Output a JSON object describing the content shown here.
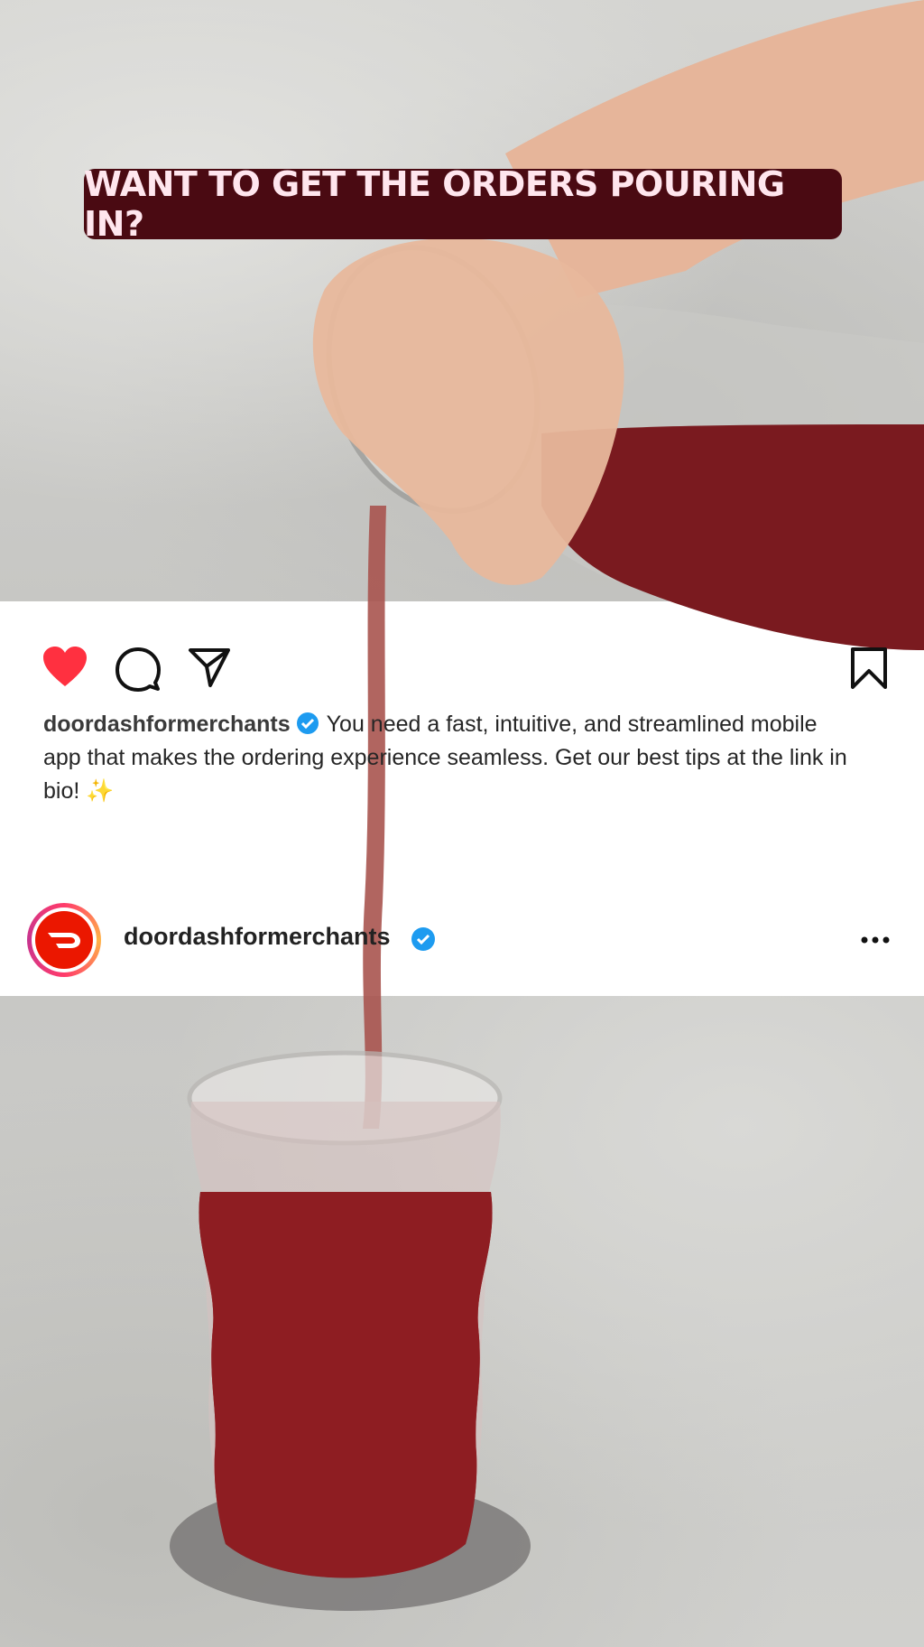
{
  "overlay": {
    "headline": "WANT TO GET THE ORDERS POURING IN?"
  },
  "post": {
    "caption_username": "doordashformerchants",
    "caption_text": "You need a fast, intuitive, and streamlined mobile app that makes the ordering experience seamless. Get our best tips at the link in bio! ✨",
    "profile_username": "doordashformerchants"
  },
  "icons": {
    "like": "heart-icon",
    "comment": "comment-icon",
    "share": "share-icon",
    "save": "bookmark-icon",
    "verified": "verified-badge-icon",
    "more": "more-options-icon"
  },
  "colors": {
    "headline_bg": "#4a0a12",
    "headline_text": "#ffe6ee",
    "like_red": "#ff3040",
    "verified_blue": "#1d9bf0",
    "brand_red": "#eb1700",
    "drink": "#8e1d22"
  }
}
